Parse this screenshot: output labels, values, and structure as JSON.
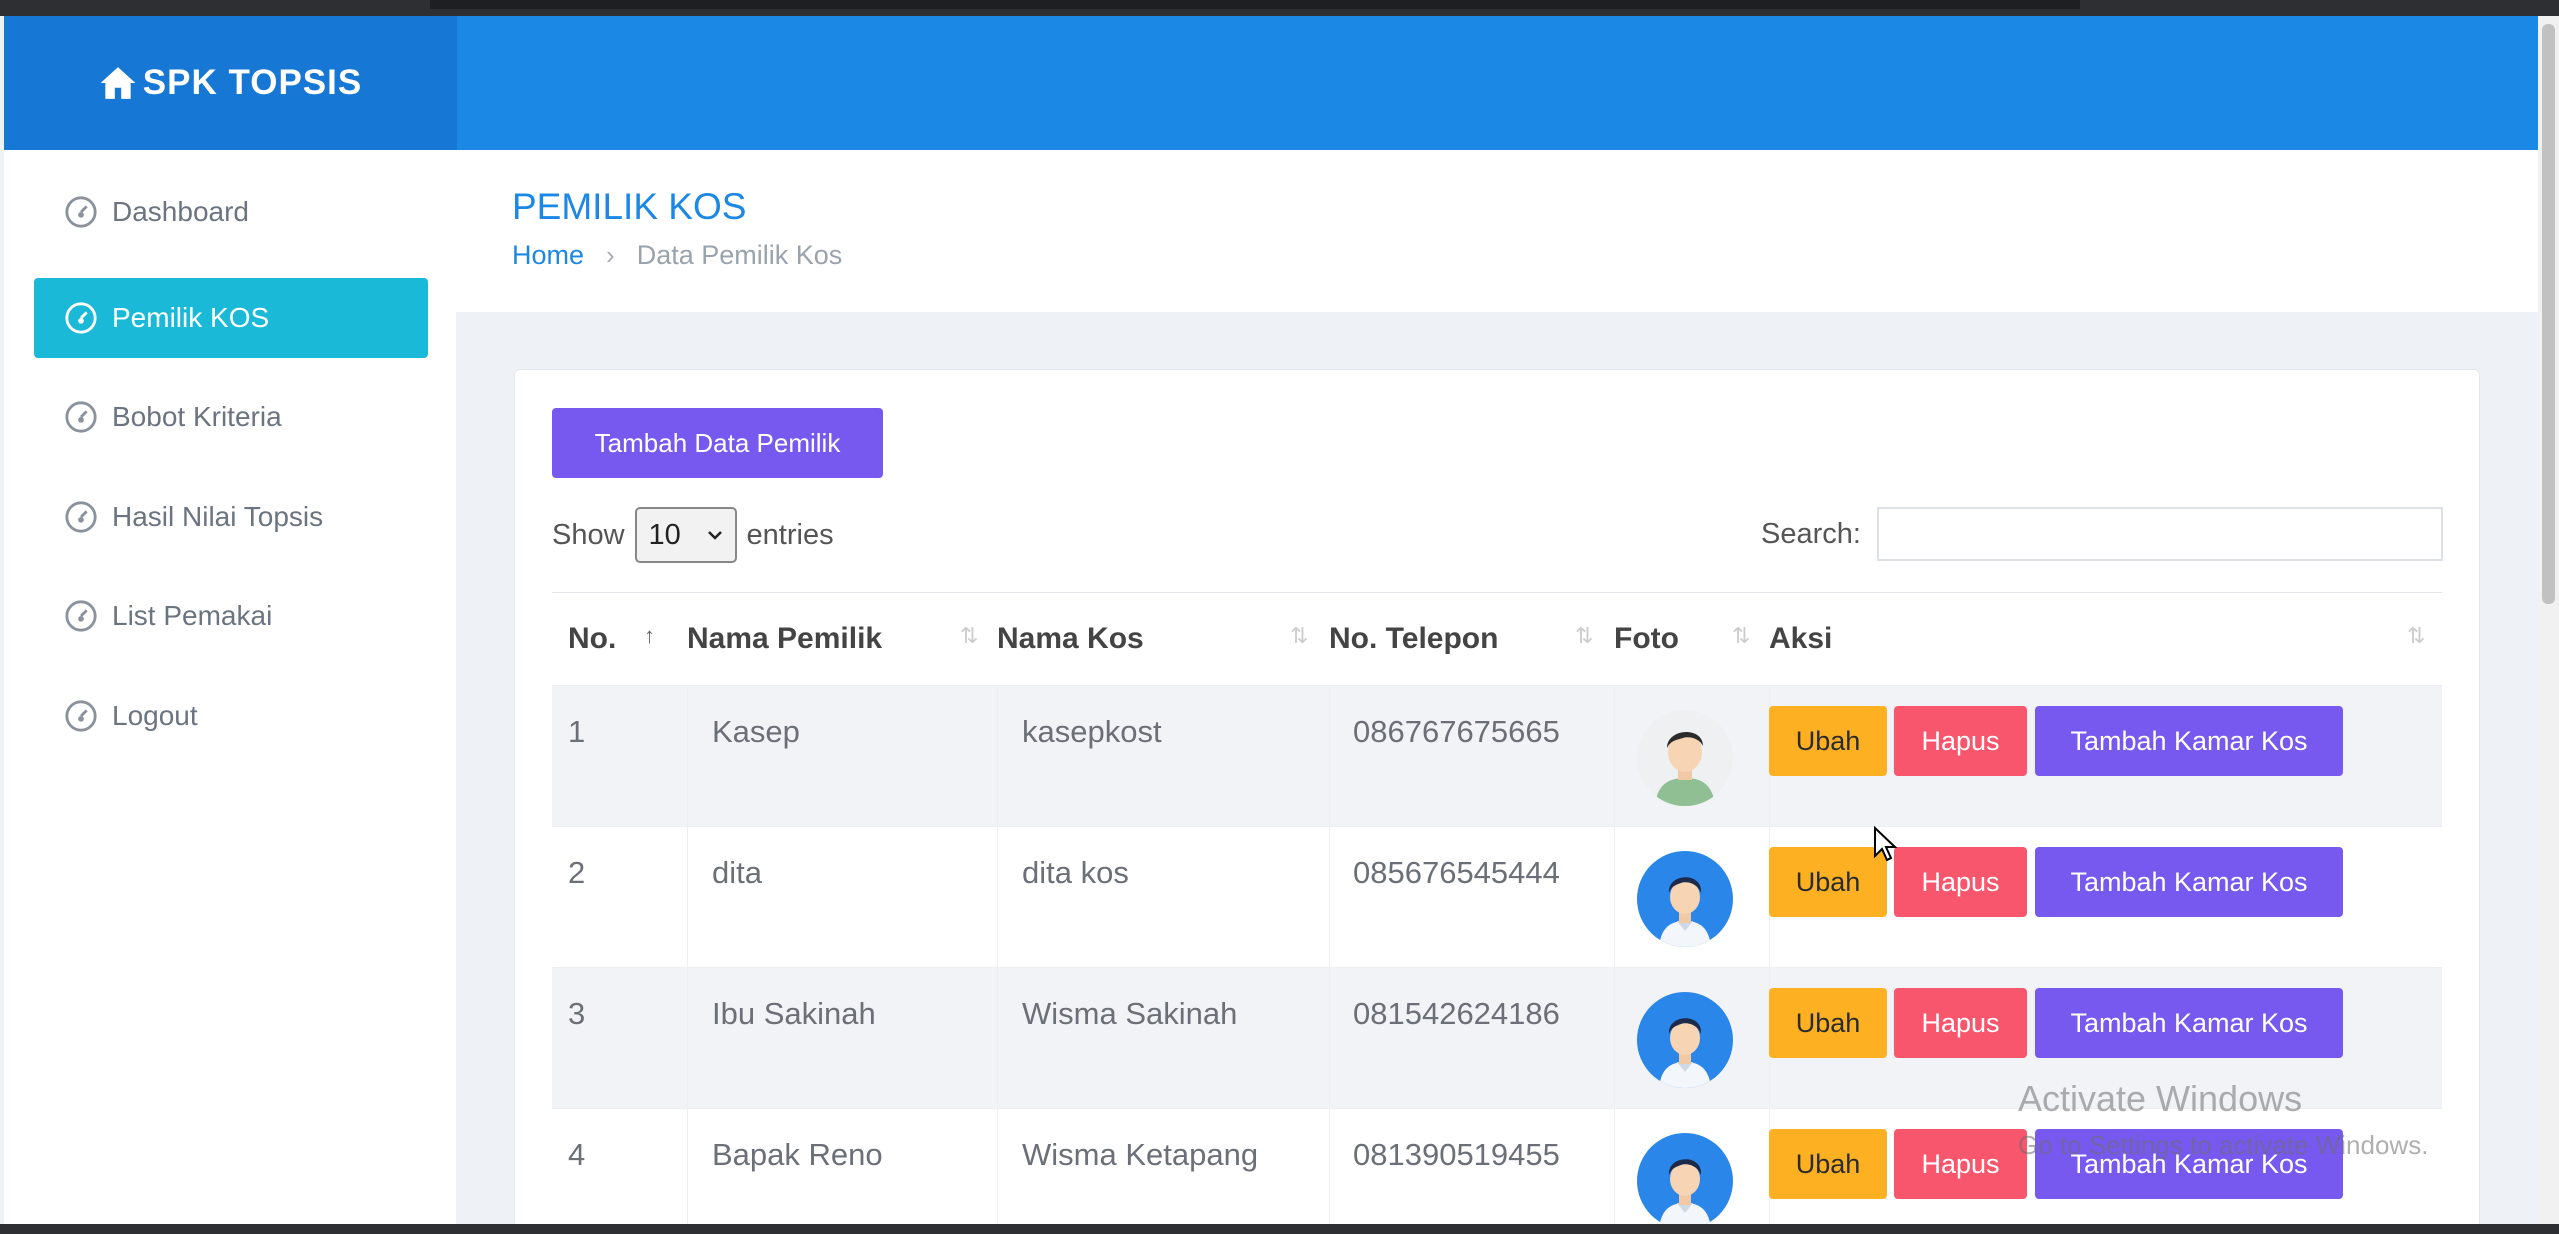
{
  "app": {
    "brand": "SPK TOPSIS"
  },
  "sidebar": {
    "items": [
      {
        "label": "Dashboard",
        "active": false
      },
      {
        "label": "Pemilik KOS",
        "active": true
      },
      {
        "label": "Bobot Kriteria",
        "active": false
      },
      {
        "label": "Hasil Nilai Topsis",
        "active": false
      },
      {
        "label": "List Pemakai",
        "active": false
      },
      {
        "label": "Logout",
        "active": false
      }
    ]
  },
  "page": {
    "title": "PEMILIK KOS",
    "breadcrumb": {
      "home": "Home",
      "current": "Data Pemilik Kos"
    }
  },
  "toolbar": {
    "add_label": "Tambah Data Pemilik",
    "show_label": "Show",
    "entries_value": "10",
    "entries_label": "entries",
    "search_label": "Search:",
    "search_value": ""
  },
  "table": {
    "headers": [
      "No.",
      "Nama Pemilik",
      "Nama Kos",
      "No. Telepon",
      "Foto",
      "Aksi"
    ],
    "rows": [
      {
        "no": "1",
        "nama_pemilik": "Kasep",
        "nama_kos": "kasepkost",
        "telepon": "086767675665",
        "foto": "male-avatar-light"
      },
      {
        "no": "2",
        "nama_pemilik": "dita",
        "nama_kos": "dita kos",
        "telepon": "085676545444",
        "foto": "male-avatar-blue"
      },
      {
        "no": "3",
        "nama_pemilik": "Ibu Sakinah",
        "nama_kos": "Wisma Sakinah",
        "telepon": "081542624186",
        "foto": "male-avatar-blue"
      },
      {
        "no": "4",
        "nama_pemilik": "Bapak Reno",
        "nama_kos": "Wisma Ketapang",
        "telepon": "081390519455",
        "foto": "male-avatar-blue"
      }
    ],
    "actions": {
      "edit": "Ubah",
      "delete": "Hapus",
      "add_room": "Tambah Kamar Kos"
    }
  },
  "overlay": {
    "watermark_title": "Activate Windows",
    "watermark_sub": "Go to Settings to activate Windows."
  },
  "colors": {
    "header": "#1b88e6",
    "brand_bg": "#1777d4",
    "active_nav": "#1bb9d8",
    "primary_button": "#7759ef",
    "edit_button": "#fdb122",
    "delete_button": "#f8566c"
  }
}
